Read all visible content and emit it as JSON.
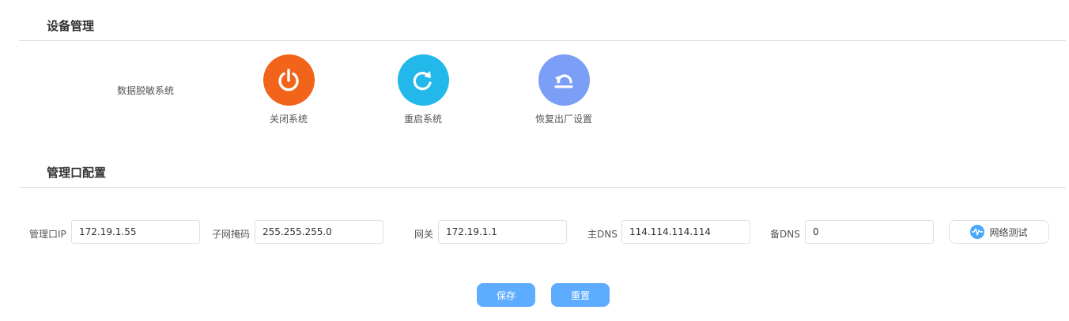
{
  "device_section": {
    "title": "设备管理",
    "system_label": "数据脱敏系统",
    "actions": [
      {
        "label": "关闭系统",
        "color": "#f26419",
        "icon": "power-icon"
      },
      {
        "label": "重启系统",
        "color": "#23b8ea",
        "icon": "restart-icon"
      },
      {
        "label": "恢复出厂设置",
        "color": "#7b9ff7",
        "icon": "restore-icon"
      }
    ]
  },
  "mgmt_section": {
    "title": "管理口配置",
    "fields": {
      "ip": {
        "label": "管理口IP",
        "value": "172.19.1.55"
      },
      "mask": {
        "label": "子网掩码",
        "value": "255.255.255.0"
      },
      "gateway": {
        "label": "网关",
        "value": "172.19.1.1"
      },
      "dns1": {
        "label": "主DNS",
        "value": "114.114.114.114"
      },
      "dns2": {
        "label": "备DNS",
        "value": "0"
      }
    },
    "test_button": "网络测试"
  },
  "buttons": {
    "save": "保存",
    "reset": "重置"
  },
  "colors": {
    "primary": "#5eacff",
    "divider": "#dcdfe6"
  }
}
